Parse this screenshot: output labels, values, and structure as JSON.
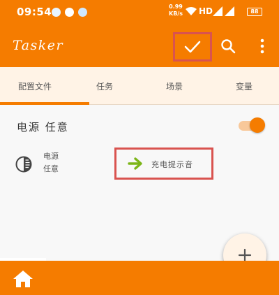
{
  "status_bar": {
    "time": "09:54",
    "net_speed_value": "0.99",
    "net_speed_unit": "KB/s",
    "network_label": "HD",
    "battery": "88"
  },
  "toolbar": {
    "app_title": "Tasker",
    "icons": {
      "confirm": "check-icon",
      "search": "search-icon",
      "more": "more-vert-icon"
    }
  },
  "tabs": [
    {
      "label": "配置文件",
      "selected": true
    },
    {
      "label": "任务",
      "selected": false
    },
    {
      "label": "场景",
      "selected": false
    },
    {
      "label": "变量",
      "selected": false
    }
  ],
  "profile": {
    "name": "电源 任意",
    "enabled": true,
    "context_line1": "电源",
    "context_line2": "任意",
    "task_name": "充电提示音"
  },
  "colors": {
    "primary": "#f57c00",
    "tab_background": "#fff3e6",
    "highlight_box": "#d9534f",
    "task_arrow": "#7cb518"
  }
}
